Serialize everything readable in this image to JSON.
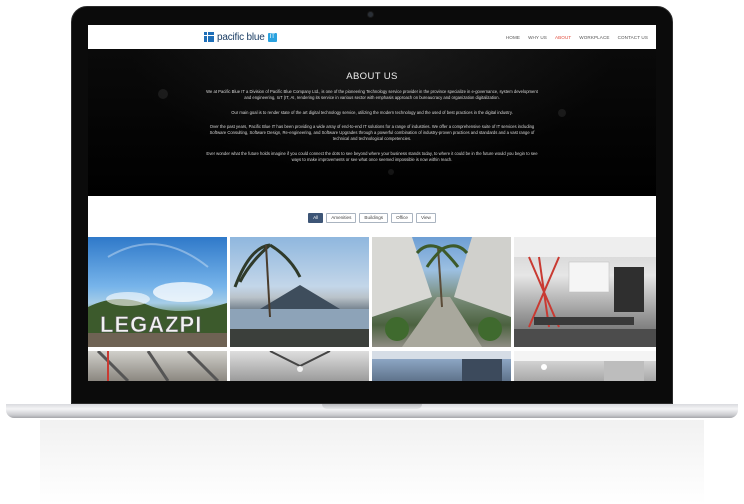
{
  "brand": {
    "name": "pacific blue",
    "badge": "IT"
  },
  "nav": {
    "items": [
      "HOME",
      "WHY US",
      "ABOUT",
      "WORKPLACE",
      "CONTACT US"
    ],
    "active": "ABOUT",
    "active_color": "#e04a3a"
  },
  "hero": {
    "title": "ABOUT US",
    "paragraphs": [
      "We at Pacific Blue IT a Division of Pacific Blue Company Ltd., is one of the pioneering Technology service provider in the province specialize in e-governance, system development and engineering, IoT (IT, AI, rendering its service in various sector with emphasis approach on bureaucracy and organization digitalization.",
      "Our main goal is to render state of the art digital technology service, utilizing the modern technology and the used of best practices in the digital industry.",
      "Over the past years, Pacific Blue IT has been providing a wide array of end-to-end IT solutions for a range of industries. We offer a comprehensive suite of IT services including Software Consulting, Software Design, Re-engineering, and Software Upgrades through a powerful combination of industry-proven practices and standards and a vast range of technical and technological competencies.",
      "Ever wonder what the future holds imagine if you could connect the dots to see beyond where your business stands today, to where it could be in the future would you begin to see ways to make improvements or see what once seemed impossible is now within reach."
    ]
  },
  "filters": {
    "items": [
      "All",
      "Amenities",
      "Buildings",
      "Office",
      "View"
    ],
    "active": "All",
    "active_color": "#3d5576"
  },
  "gallery": {
    "tile1_sign": "LEGAZPI",
    "next_icon": "chevron-right-icon"
  }
}
